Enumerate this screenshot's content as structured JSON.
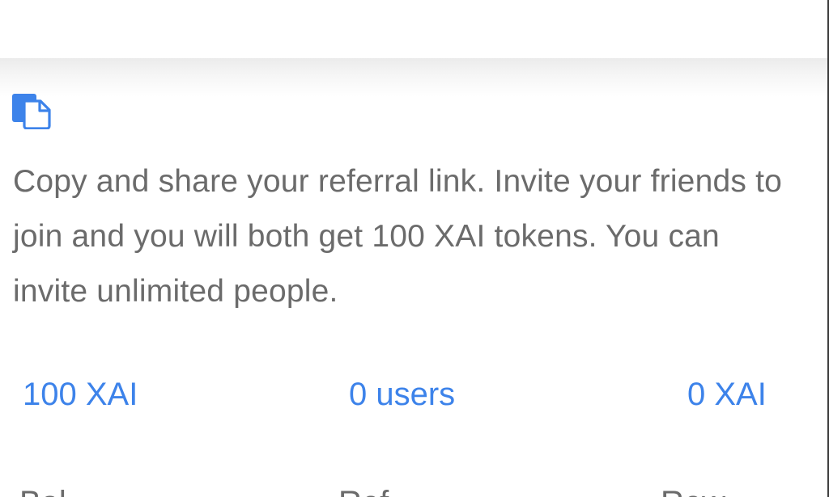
{
  "header": {},
  "referral": {
    "copy_icon": "copy-link-icon",
    "description": "Copy and share your referral link. Invite your friends to join and you will both get 100 XAI tokens. You can invite unlimited people."
  },
  "stats": {
    "balance_value": "100 XAI",
    "referrals_value": "0 users",
    "rewards_value": "0 XAI"
  },
  "labels": {
    "balance": "Bal",
    "referrals": "Ref",
    "rewards": "Rew"
  },
  "colors": {
    "accent": "#3d83ea",
    "text": "#6b6b6b",
    "background": "#ffffff"
  }
}
